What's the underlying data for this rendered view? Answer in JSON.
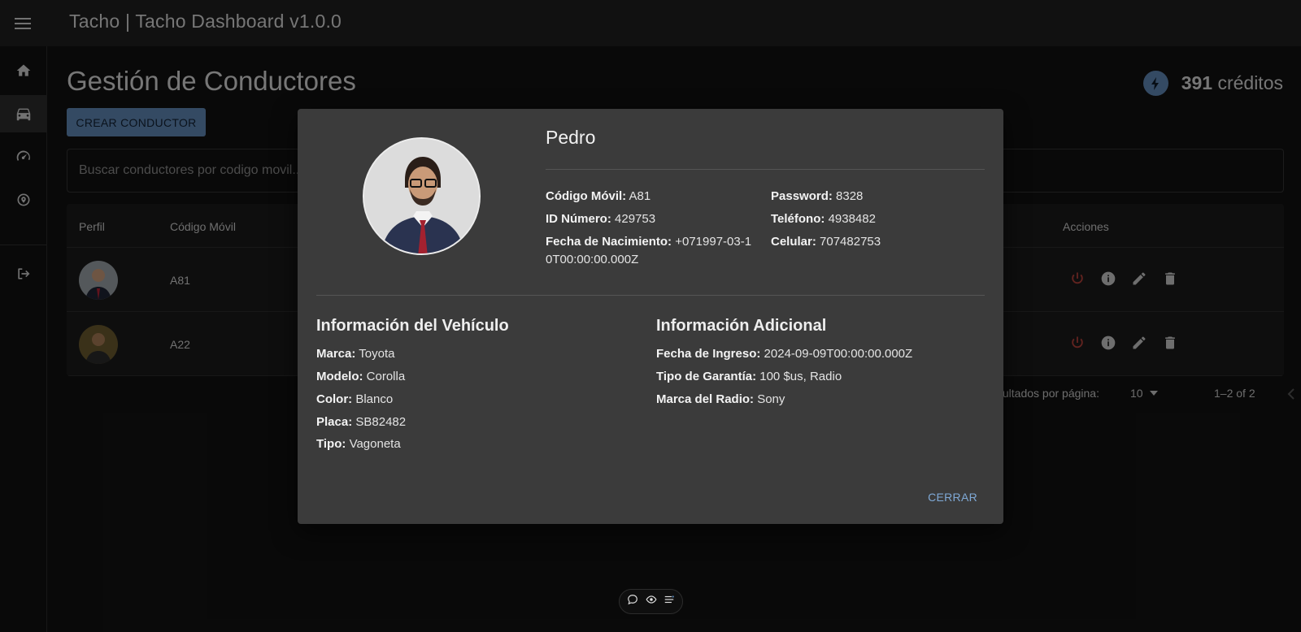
{
  "app": {
    "title": "Tacho | Tacho Dashboard v1.0.0"
  },
  "sidebar": {
    "items": [
      {
        "name": "home",
        "icon": "home-icon"
      },
      {
        "name": "drivers",
        "icon": "car-icon",
        "active": true
      },
      {
        "name": "speed",
        "icon": "speedometer-icon"
      },
      {
        "name": "location",
        "icon": "location-icon"
      },
      {
        "name": "logout",
        "icon": "logout-icon"
      }
    ]
  },
  "page": {
    "title": "Gestión de Conductores",
    "credits_amount": "391",
    "credits_label": "créditos",
    "create_button": "CREAR CONDUCTOR",
    "search_placeholder": "Buscar conductores por codigo movil..."
  },
  "table": {
    "headers": {
      "profile": "Perfil",
      "code": "Código Móvil",
      "actions": "Acciones"
    },
    "rows": [
      {
        "code": "A81"
      },
      {
        "code": "A22"
      }
    ],
    "pagination": {
      "rows_label": "Resultados por página:",
      "rows_value": "10",
      "range": "1–2 of 2"
    }
  },
  "dialog": {
    "name": "Pedro",
    "personal": {
      "codigo_label": "Código Móvil:",
      "codigo": "A81",
      "id_label": "ID Número:",
      "id": "429753",
      "nacimiento_label": "Fecha de Nacimiento:",
      "nacimiento": "+071997-03-10T00:00:00.000Z",
      "password_label": "Password:",
      "password": "8328",
      "telefono_label": "Teléfono:",
      "telefono": "4938482",
      "celular_label": "Celular:",
      "celular": "707482753"
    },
    "vehicle": {
      "title": "Información del Vehículo",
      "marca_label": "Marca:",
      "marca": "Toyota",
      "modelo_label": "Modelo:",
      "modelo": "Corolla",
      "color_label": "Color:",
      "color": "Blanco",
      "placa_label": "Placa:",
      "placa": "SB82482",
      "tipo_label": "Tipo:",
      "tipo": "Vagoneta"
    },
    "additional": {
      "title": "Información Adicional",
      "ingreso_label": "Fecha de Ingreso:",
      "ingreso": "2024-09-09T00:00:00.000Z",
      "garantia_label": "Tipo de Garantía:",
      "garantia": "100 $us, Radio",
      "radio_label": "Marca del Radio:",
      "radio": "Sony"
    },
    "close_button": "CERRAR"
  },
  "colors": {
    "accent": "#5f87b4",
    "danger": "#c0392b",
    "link": "#7fa9d6"
  }
}
